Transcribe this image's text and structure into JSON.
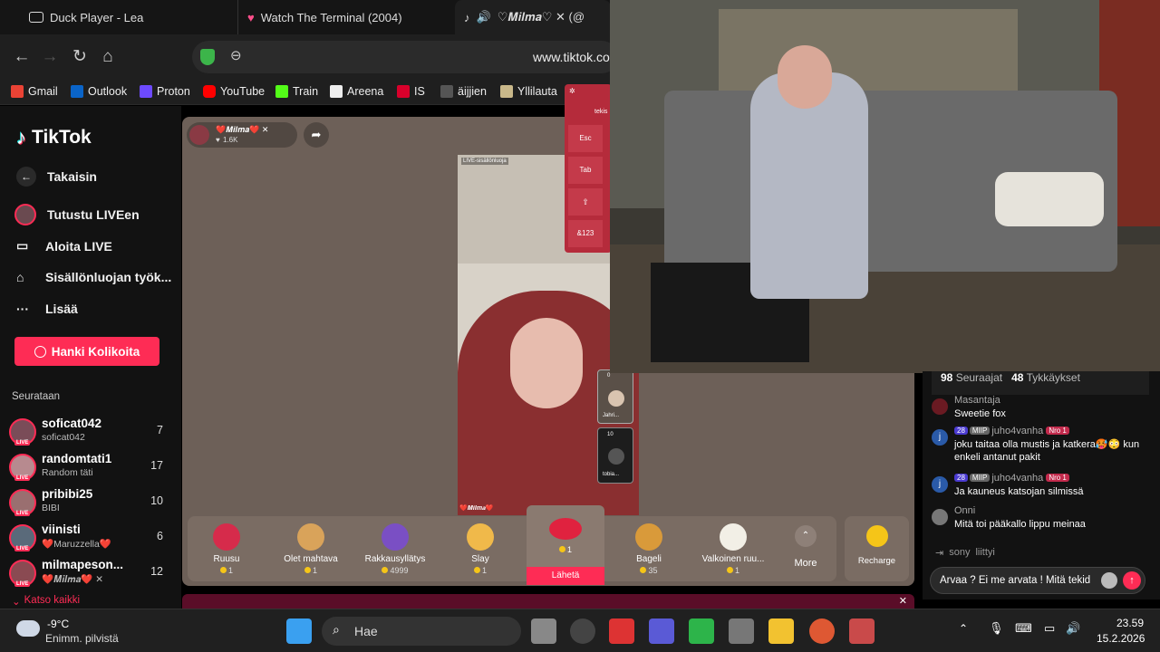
{
  "browser": {
    "tabs": [
      {
        "title": "Duck Player - Lea"
      },
      {
        "title": "Watch The Terminal (2004)"
      },
      {
        "title": "♡𝑴𝒊𝒍𝒎𝒂♡ ✕ (@"
      }
    ],
    "url": "www.tiktok.co",
    "bookmarks": [
      {
        "label": "Gmail"
      },
      {
        "label": "Outlook"
      },
      {
        "label": "Proton"
      },
      {
        "label": "YouTube"
      },
      {
        "label": "Train"
      },
      {
        "label": "Areena"
      },
      {
        "label": "IS"
      },
      {
        "label": "äijjien"
      },
      {
        "label": "Yllilauta"
      }
    ]
  },
  "keyboard": {
    "header_left": "tekis",
    "keys": [
      "Esc",
      "Tab",
      "⇧",
      "&123"
    ]
  },
  "sidebar": {
    "logo": "TikTok",
    "back_label": "Takaisin",
    "items": [
      {
        "label": "Tutustu LIVEen"
      },
      {
        "label": "Aloita LIVE"
      },
      {
        "label": "Sisällönluojan työk..."
      },
      {
        "label": "Lisää"
      }
    ],
    "coins_button": "Hanki Kolikoita",
    "following_heading": "Seurataan",
    "following": [
      {
        "name": "soficat042",
        "sub": "soficat042",
        "count": "7"
      },
      {
        "name": "randomtati1",
        "sub": "Random täti",
        "count": "17"
      },
      {
        "name": "pribibi25",
        "sub": "BIBI",
        "count": "10"
      },
      {
        "name": "viinisti",
        "sub": "❤️Maruzzella❤️",
        "count": "6"
      },
      {
        "name": "milmapeson...",
        "sub": "❤️𝑴𝒊𝒍𝒎𝒂❤️ ✕",
        "count": "12"
      }
    ],
    "see_all": "Katso kaikki",
    "live_badge": "LIVE"
  },
  "stream": {
    "host_name": "❤️𝑴𝒊𝒍𝒎𝒂❤️ ✕",
    "host_likes": "1.6K",
    "live_tag": "LIVE-sisällönluoja",
    "bottom_name": "❤️𝑴𝒊𝒍𝒎𝒂❤️",
    "guests": [
      {
        "name": "Jahri...",
        "count": "0"
      },
      {
        "name": "tobia...",
        "count": "10"
      }
    ]
  },
  "gifts": {
    "items": [
      {
        "name": "Ruusu",
        "price": "1",
        "color": "#d62b4b"
      },
      {
        "name": "Olet mahtava",
        "price": "1",
        "color": "#d9a35a"
      },
      {
        "name": "Rakkausyllätys",
        "price": "4999",
        "color": "#7a4fc4"
      },
      {
        "name": "Slay",
        "price": "1",
        "color": "#f0b94a"
      },
      {
        "name": "Bageli",
        "price": "35",
        "color": "#d99a3a"
      },
      {
        "name": "Valkoinen ruu...",
        "price": "1",
        "color": "#f2efe6"
      }
    ],
    "featured_price": "1",
    "send_label": "Lähetä",
    "more_label": "More",
    "recharge_label": "Recharge"
  },
  "chat": {
    "followers": "98",
    "followers_label": "Seuraajat",
    "likes": "48",
    "likes_label": "Tykkäykset",
    "messages": [
      {
        "user": "Masantaja",
        "text": "Sweetie fox",
        "level": "",
        "tag": "",
        "rank": ""
      },
      {
        "user": "juho4vanha",
        "level": "28",
        "tag": "MIIP",
        "rank": "Nro 1",
        "text": "joku taitaa olla mustis ja katkera🥵😳 kun enkeli antanut pakit"
      },
      {
        "user": "juho4vanha",
        "level": "28",
        "tag": "MIIP",
        "rank": "Nro 1",
        "text": "Ja kauneus katsojan silmissä"
      },
      {
        "user": "Onni",
        "text": "Mitä toi pääkallo lippu meinaa",
        "level": "",
        "tag": "",
        "rank": ""
      }
    ],
    "join_user": "sony",
    "join_text": "liittyi",
    "input_value": "Arvaa ? Ei me arvata ! Mitä tekid"
  },
  "taskbar": {
    "temp": "-9°C",
    "weather": "Enimm. pilvistä",
    "search_placeholder": "Hae",
    "time": "23.59",
    "date": "15.2.2026"
  }
}
